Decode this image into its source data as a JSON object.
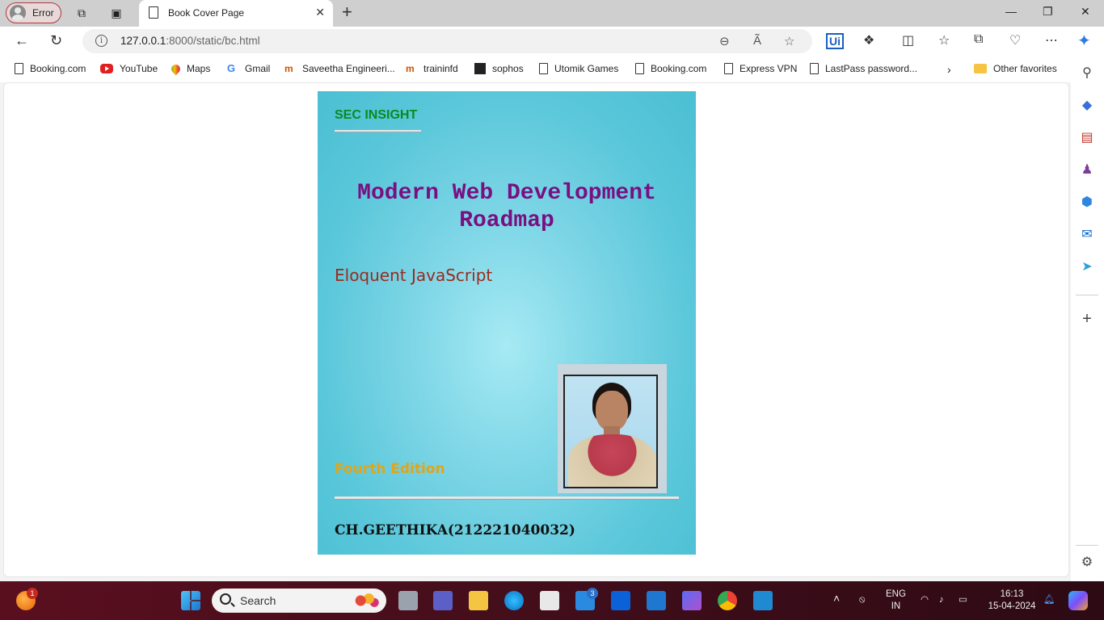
{
  "browser": {
    "profile_label": "Error",
    "tab_title": "Book Cover Page",
    "url_host": "127.0.0.1",
    "url_rest": ":8000/static/bc.html"
  },
  "favorites": [
    {
      "label": "Booking.com",
      "icon": "doc-icon"
    },
    {
      "label": "YouTube",
      "icon": "youtube-icon"
    },
    {
      "label": "Maps",
      "icon": "maps-icon"
    },
    {
      "label": "Gmail",
      "icon": "google-icon"
    },
    {
      "label": "Saveetha Engineeri...",
      "icon": "saveetha-icon"
    },
    {
      "label": "traininfd",
      "icon": "saveetha-icon"
    },
    {
      "label": "sophos",
      "icon": "sophos-icon"
    },
    {
      "label": "Utomik Games",
      "icon": "doc-icon"
    },
    {
      "label": "Booking.com",
      "icon": "doc-icon"
    },
    {
      "label": "Express VPN",
      "icon": "doc-icon"
    },
    {
      "label": "LastPass password...",
      "icon": "doc-icon"
    }
  ],
  "other_favorites": "Other favorites",
  "cover": {
    "brand": "SEC INSIGHT",
    "title_line1": "Modern Web Development",
    "title_line2": "Roadmap",
    "subtitle": "Eloquent JavaScript",
    "edition": "Fourth Edition",
    "author": "CH.GEETHIKA(212221040032)"
  },
  "taskbar": {
    "search_placeholder": "Search",
    "notification_count": "1",
    "mail_badge": "3",
    "lang_line1": "ENG",
    "lang_line2": "IN",
    "time": "16:13",
    "date": "15-04-2024"
  },
  "colors": {
    "brand": "#0a8a1e",
    "title": "#7a0f82",
    "subtitle": "#9b2a1e",
    "edition": "#e0a51c",
    "cover_bg": "#5ac7da"
  }
}
